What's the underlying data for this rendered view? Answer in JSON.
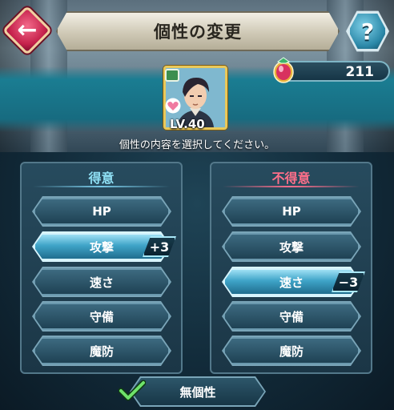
{
  "header": {
    "title": "個性の変更"
  },
  "icons": {
    "back": "back-arrow-icon",
    "help": "help-question-icon",
    "orb": "orb-icon",
    "check": "check-icon"
  },
  "orbs": {
    "count": "211"
  },
  "hero": {
    "level": "LV.40"
  },
  "instruction": "個性の内容を選択してください。",
  "boon_panel": {
    "title": "得意",
    "stats": [
      {
        "label": "HP",
        "selected": false
      },
      {
        "label": "攻撃",
        "selected": true,
        "modifier": "+3"
      },
      {
        "label": "速さ",
        "selected": false
      },
      {
        "label": "守備",
        "selected": false
      },
      {
        "label": "魔防",
        "selected": false
      }
    ]
  },
  "bane_panel": {
    "title": "不得意",
    "stats": [
      {
        "label": "HP",
        "selected": false
      },
      {
        "label": "攻撃",
        "selected": false
      },
      {
        "label": "速さ",
        "selected": true,
        "modifier": "−3"
      },
      {
        "label": "守備",
        "selected": false
      },
      {
        "label": "魔防",
        "selected": false
      }
    ]
  },
  "neutral_button": {
    "label": "無個性",
    "checked": true
  },
  "colors": {
    "boon": "#8fe0f5",
    "bane": "#ff6f8a",
    "gold_frame": "#e9c95a",
    "back_button": "#c5214b"
  }
}
